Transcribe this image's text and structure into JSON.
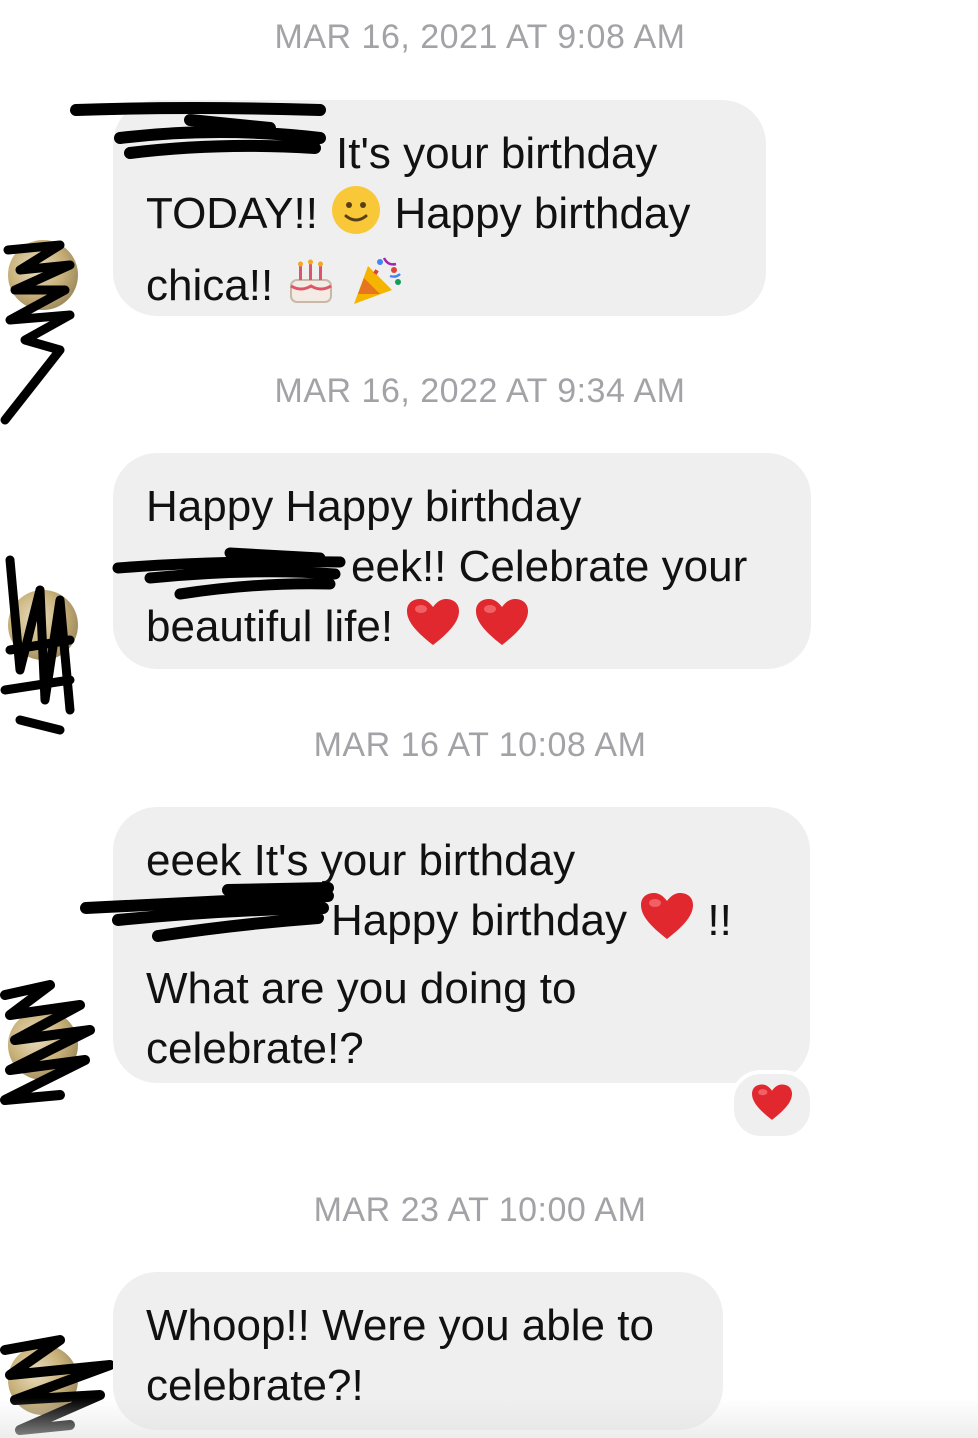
{
  "messages": [
    {
      "timestamp": "MAR 16, 2021 AT 9:08 AM",
      "lines": [
        "It's your birthday",
        "TODAY!!",
        "Happy birthday",
        "chica!!"
      ]
    },
    {
      "timestamp": "MAR 16, 2022 AT 9:34 AM",
      "lines": [
        "Happy Happy birthday",
        "eek!! Celebrate your",
        "beautiful life!"
      ]
    },
    {
      "timestamp": "MAR 16 AT 10:08 AM",
      "lines": [
        "eeek It's your birthday",
        "Happy birthday",
        "!!",
        "What are you doing to",
        "celebrate!?"
      ],
      "reaction": "heart-icon"
    },
    {
      "timestamp": "MAR 23 AT 10:00 AM",
      "lines": [
        "Whoop!! Were you able to",
        "celebrate?!"
      ]
    }
  ],
  "icons": {
    "smile": "slightly-smiling-face-icon",
    "cake": "birthday-cake-icon",
    "party": "party-popper-icon",
    "heart": "red-heart-icon"
  },
  "colors": {
    "bubble": "#efefef",
    "timestamp": "#a3a3a7",
    "heart": "#e0282e"
  }
}
